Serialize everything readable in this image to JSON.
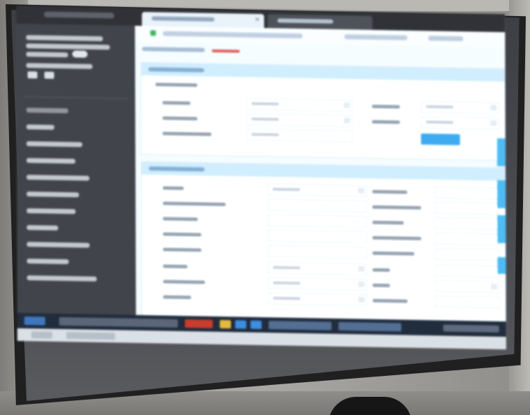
{
  "scene": {
    "description_free": true,
    "colors": {
      "wall": "#a8a7a3",
      "screen_border": "#202021",
      "sidebar": "#3e4147",
      "content_bg": "#eaf1f7",
      "panel_header": "#c7e3f3",
      "accent_blue": "#3aa3e6",
      "breadcrumb_accent": "#d4574f",
      "taskbar": "#1f2a3a"
    }
  },
  "icons": {
    "back": "arrow-left-icon",
    "forward": "arrow-right-icon",
    "refresh": "refresh-icon",
    "secure": "lock-icon",
    "close_tab": "close-icon"
  }
}
